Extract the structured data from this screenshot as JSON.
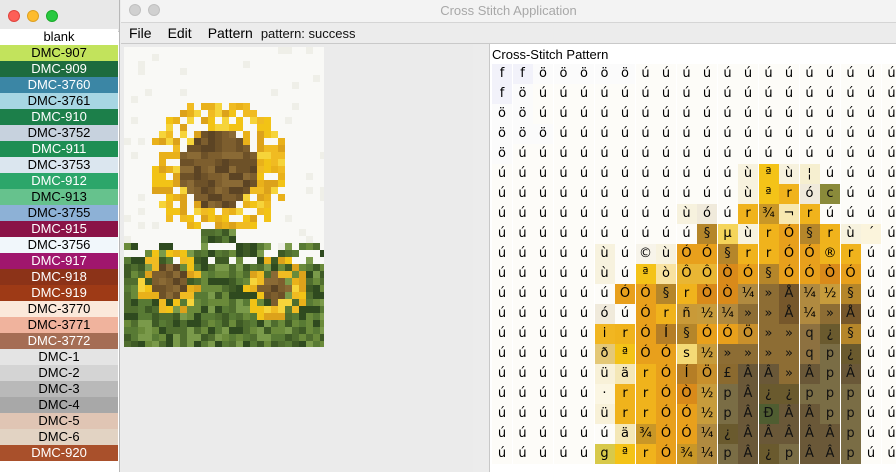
{
  "app": {
    "title": "Cross Stitch Application"
  },
  "menu": {
    "file": "File",
    "edit": "Edit",
    "pattern": "Pattern"
  },
  "status": "pattern: success",
  "pattern_label": "Cross-Stitch Pattern",
  "palette": [
    {
      "name": "blank",
      "color": "#ffffff"
    },
    {
      "name": "DMC-907",
      "color": "#c2e35c"
    },
    {
      "name": "DMC-909",
      "color": "#1d6b3e"
    },
    {
      "name": "DMC-3760",
      "color": "#3b86a5"
    },
    {
      "name": "DMC-3761",
      "color": "#a7d6e3"
    },
    {
      "name": "DMC-910",
      "color": "#1c7f4a"
    },
    {
      "name": "DMC-3752",
      "color": "#c7d2de"
    },
    {
      "name": "DMC-911",
      "color": "#1e8e53"
    },
    {
      "name": "DMC-3753",
      "color": "#dbe6ef"
    },
    {
      "name": "DMC-912",
      "color": "#2ca66a"
    },
    {
      "name": "DMC-913",
      "color": "#66c28d"
    },
    {
      "name": "DMC-3755",
      "color": "#8db1d6"
    },
    {
      "name": "DMC-915",
      "color": "#8a1347"
    },
    {
      "name": "DMC-3756",
      "color": "#f1f7fb"
    },
    {
      "name": "DMC-917",
      "color": "#a0166d"
    },
    {
      "name": "DMC-918",
      "color": "#8c3318"
    },
    {
      "name": "DMC-919",
      "color": "#9e3a16"
    },
    {
      "name": "DMC-3770",
      "color": "#fbe9db"
    },
    {
      "name": "DMC-3771",
      "color": "#f0b39d"
    },
    {
      "name": "DMC-3772",
      "color": "#a56d54"
    },
    {
      "name": "DMC-1",
      "color": "#e4e4e4"
    },
    {
      "name": "DMC-2",
      "color": "#d4d4d4"
    },
    {
      "name": "DMC-3",
      "color": "#b9b9b9"
    },
    {
      "name": "DMC-4",
      "color": "#a8a8a8"
    },
    {
      "name": "DMC-5",
      "color": "#e0c5b4"
    },
    {
      "name": "DMC-6",
      "color": "#e2d3c3"
    },
    {
      "name": "DMC-920",
      "color": "#a9502b"
    }
  ],
  "grid_rows": [
    [
      "f",
      "f",
      "ö",
      "ö",
      "ö",
      "ö",
      "ö",
      "ú",
      "ú",
      "ú",
      "ú",
      "ú",
      "ú",
      "ú",
      "ú",
      "ú",
      "ú",
      "ú",
      "ú",
      "ú"
    ],
    [
      "f",
      "ö",
      "ú",
      "ú",
      "ú",
      "ú",
      "ú",
      "ú",
      "ú",
      "ú",
      "ú",
      "ú",
      "ú",
      "ú",
      "ú",
      "ú",
      "ú",
      "ú",
      "ú",
      "ú"
    ],
    [
      "ö",
      "ö",
      "ú",
      "ú",
      "ú",
      "ú",
      "ú",
      "ú",
      "ú",
      "ú",
      "ú",
      "ú",
      "ú",
      "ú",
      "ú",
      "ú",
      "ú",
      "ú",
      "ú",
      "ú"
    ],
    [
      "ö",
      "ö",
      "ö",
      "ú",
      "ú",
      "ú",
      "ú",
      "ú",
      "ú",
      "ú",
      "ú",
      "ú",
      "ú",
      "ú",
      "ú",
      "ú",
      "ú",
      "ú",
      "ú",
      "ú"
    ],
    [
      "ö",
      "ú",
      "ú",
      "ú",
      "ú",
      "ú",
      "ú",
      "ú",
      "ú",
      "ú",
      "ú",
      "ú",
      "ú",
      "ú",
      "ú",
      "ú",
      "ú",
      "ú",
      "ú",
      "ú"
    ],
    [
      "ú",
      "ú",
      "ú",
      "ú",
      "ú",
      "ú",
      "ú",
      "ú",
      "ú",
      "ú",
      "ú",
      "ú",
      "ù",
      "ª",
      "ù",
      "¦",
      "ú",
      "ú",
      "ú",
      "ú"
    ],
    [
      "ú",
      "ú",
      "ú",
      "ú",
      "ú",
      "ú",
      "ú",
      "ú",
      "ú",
      "ú",
      "ú",
      "ú",
      "ù",
      "ª",
      "r",
      "ó",
      "c",
      "ú",
      "ú",
      "ú"
    ],
    [
      "ú",
      "ú",
      "ú",
      "ú",
      "ú",
      "ú",
      "ú",
      "ú",
      "ú",
      "ù",
      "ó",
      "ú",
      "r",
      "¾",
      "¬",
      "r",
      "ú",
      "ú",
      "ú",
      "ú"
    ],
    [
      "ú",
      "ú",
      "ú",
      "ú",
      "ú",
      "ú",
      "ú",
      "ú",
      "ú",
      "ú",
      "§",
      "µ",
      "ù",
      "r",
      "Ó",
      "§",
      "r",
      "ù",
      "´",
      "ú"
    ],
    [
      "ú",
      "ú",
      "ú",
      "ú",
      "ú",
      "ù",
      "ú",
      "©",
      "ù",
      "Ó",
      "Ó",
      "§",
      "r",
      "r",
      "Ó",
      "Ó",
      "®",
      "r",
      "ú",
      "ú"
    ],
    [
      "ú",
      "ú",
      "ú",
      "ú",
      "ú",
      "ù",
      "ú",
      "ª",
      "ò",
      "Ô",
      "Ô",
      "Ò",
      "Ó",
      "§",
      "Ó",
      "Ó",
      "Ò",
      "Ó",
      "ú",
      "ú"
    ],
    [
      "ú",
      "ú",
      "ú",
      "ú",
      "ú",
      "ú",
      "Ó",
      "Ó",
      "§",
      "r",
      "Ò",
      "Ò",
      "¼",
      "»",
      "Å",
      "¼",
      "½",
      "§",
      "ú",
      "ú"
    ],
    [
      "ú",
      "ú",
      "ú",
      "ú",
      "ú",
      "ó",
      "ú",
      "Ó",
      "r",
      "ñ",
      "½",
      "¼",
      "»",
      "»",
      "Å",
      "¼",
      "»",
      "Å",
      "ú",
      "ú"
    ],
    [
      "ú",
      "ú",
      "ú",
      "ú",
      "ú",
      "i",
      "r",
      "Ó",
      "Í",
      "§",
      "Ó",
      "Ó",
      "Ö",
      "»",
      "»",
      "q",
      "¿",
      "§",
      "ú",
      "ú"
    ],
    [
      "ú",
      "ú",
      "ú",
      "ú",
      "ú",
      "ð",
      "ª",
      "Ó",
      "Ó",
      "s",
      "½",
      "»",
      "»",
      "»",
      "»",
      "q",
      "p",
      "¿",
      "ú",
      "ú"
    ],
    [
      "ú",
      "ú",
      "ú",
      "ú",
      "ú",
      "ü",
      "ä",
      "r",
      "Ó",
      "Í",
      "Ö",
      "£",
      "Â",
      "Â",
      "»",
      "Â",
      "p",
      "Â",
      "ú",
      "ú"
    ],
    [
      "ú",
      "ú",
      "ú",
      "ú",
      "ú",
      "·",
      "r",
      "r",
      "Ó",
      "Ò",
      "½",
      "p",
      "Â",
      "¿",
      "¿",
      "p",
      "p",
      "p",
      "ú",
      "ú"
    ],
    [
      "ú",
      "ú",
      "ú",
      "ú",
      "ú",
      "ü",
      "r",
      "r",
      "Ó",
      "Ó",
      "½",
      "p",
      "Â",
      "Ð",
      "Â",
      "Â",
      "p",
      "p",
      "ú",
      "ú"
    ],
    [
      "ú",
      "ú",
      "ú",
      "ú",
      "ú",
      "ú",
      "ä",
      "¾",
      "Ó",
      "Ó",
      "¼",
      "¿",
      "Â",
      "Â",
      "Â",
      "Â",
      "Â",
      "p",
      "ú",
      "ú"
    ],
    [
      "ú",
      "ú",
      "ú",
      "ú",
      "ú",
      "g",
      "ª",
      "r",
      "Ó",
      "¾",
      "¼",
      "p",
      "Â",
      "¿",
      "p",
      "Â",
      "Â",
      "p",
      "ú",
      "ú"
    ]
  ]
}
